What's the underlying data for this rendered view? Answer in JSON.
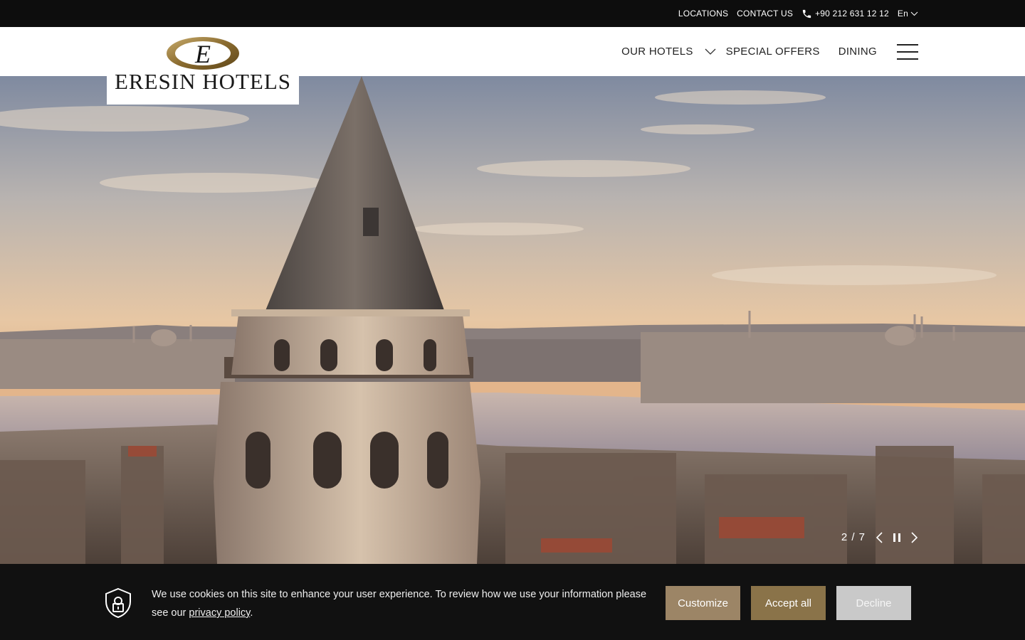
{
  "topbar": {
    "locations": "LOCATIONS",
    "contact": "CONTACT US",
    "phone": "+90 212 631 12 12",
    "language": "En"
  },
  "logo": {
    "text": "ERESIN HOTELS",
    "monogram": "E"
  },
  "nav": {
    "our_hotels": "OUR HOTELS",
    "special_offers": "SPECIAL OFFERS",
    "dining": "DINING"
  },
  "hero": {
    "slide_counter": "2 / 7"
  },
  "cookie": {
    "message": "We use cookies on this site to enhance your user experience. To review how we use your information please see our",
    "link": "privacy policy",
    "period": ".",
    "customize": "Customize",
    "accept": "Accept all",
    "decline": "Decline"
  },
  "colors": {
    "topbar_bg": "#0d0d0d",
    "gold": "#8a7349",
    "customize_bg": "#9c8566",
    "decline_bg": "#c9c9c9"
  }
}
